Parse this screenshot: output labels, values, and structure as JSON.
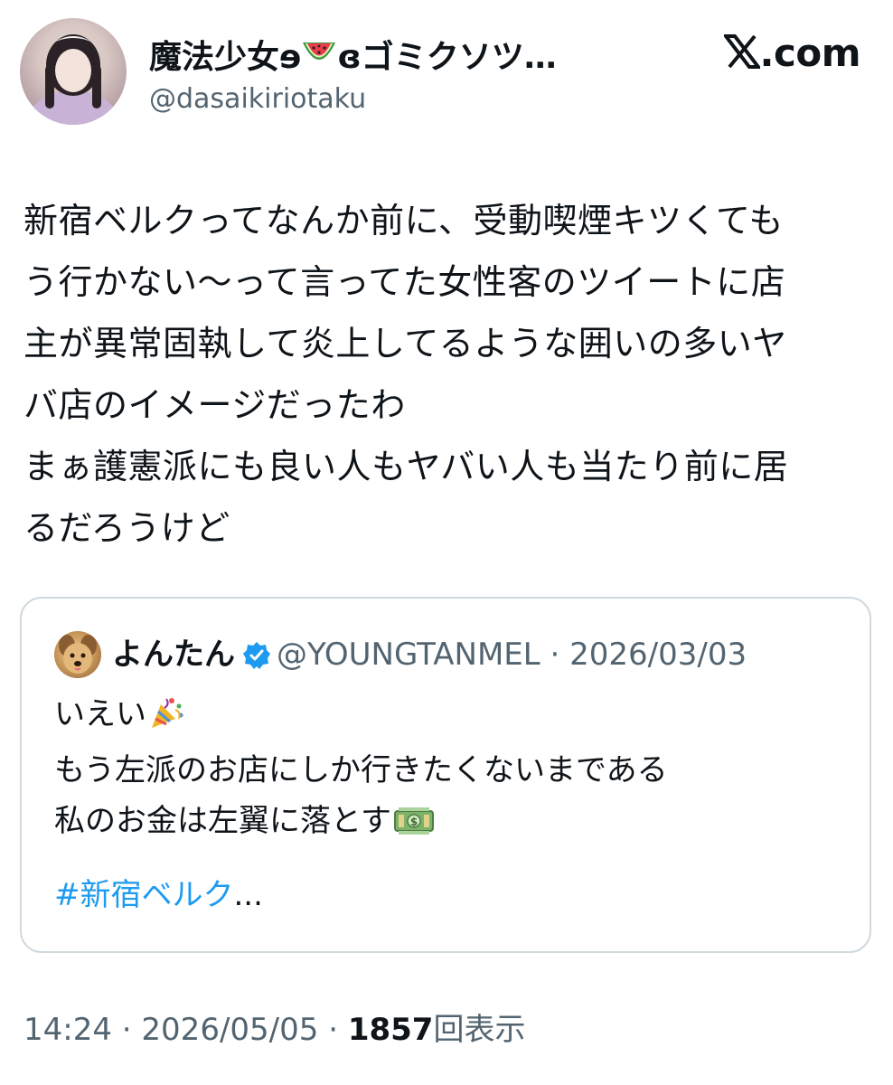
{
  "header": {
    "display_name_prefix": "魔法少女ɘ",
    "display_name_emoji": "watermelon",
    "display_name_suffix": "ɞゴミクソツ…",
    "handle": "@dasaikiriotaku",
    "site_badge": ".com",
    "site_logo": "x-logo"
  },
  "tweet": {
    "lines": [
      "新宿ベルクってなんか前に、受動喫煙キツくても",
      "う行かない〜って言ってた女性客のツイートに店",
      "主が異常固執して炎上してるような囲いの多いヤ",
      "バ店のイメージだったわ",
      "まぁ護憲派にも良い人もヤバい人も当たり前に居",
      "るだろうけど"
    ]
  },
  "quote": {
    "name": "よんたん",
    "verified_icon": "verified-badge",
    "handle": "@YOUNGTANMEL",
    "separator": " · ",
    "date": "2026/03/03",
    "lines": [
      "いえい",
      "もう左派のお店にしか行きたくないまである",
      "私のお金は左翼に落とす"
    ],
    "line_emojis": [
      "party-popper",
      "",
      "money-bag"
    ],
    "hashtag": "#新宿ベルク",
    "truncation": "..."
  },
  "footer": {
    "time": "14:24",
    "sep1": " · ",
    "date": "2026/05/05",
    "sep2": " · ",
    "views": "1857",
    "views_label": "回表示"
  },
  "colors": {
    "text": "#0f1419",
    "secondary": "#536471",
    "link": "#1d9bf0",
    "border": "#cfd9de",
    "verified": "#1d9bf0"
  }
}
